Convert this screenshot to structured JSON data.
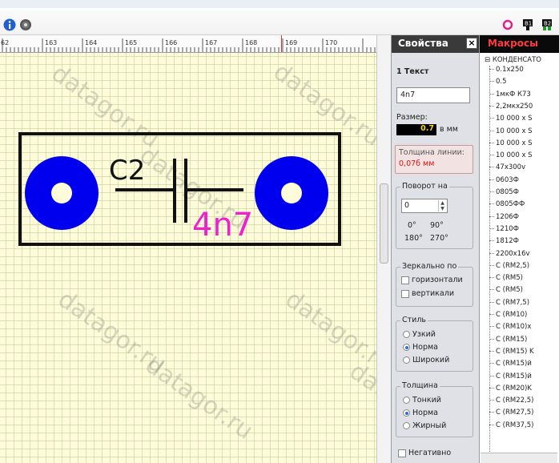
{
  "toolbar": {
    "left_icons": [
      "info-icon",
      "gear-icon"
    ],
    "right_icons": [
      "ring-icon",
      "layer-tool-icon",
      "layer-tool-2-icon"
    ],
    "icon_labels": {
      "layer1": "B1",
      "layer2": "B2"
    }
  },
  "ruler": {
    "labels": [
      "62",
      "163",
      "164",
      "165",
      "166",
      "167",
      "168",
      "169",
      "170"
    ]
  },
  "canvas": {
    "designator": "C2",
    "value": "4n7",
    "watermark": "datagor.ru",
    "colors": {
      "pad": "#0000ee",
      "silk": "#111111",
      "value_text": "#ee22cc",
      "background": "#fdfbd9"
    }
  },
  "props": {
    "title": "Свойства",
    "close": "×",
    "section": "1 Текст",
    "text_value": "4n7",
    "size_label": "Размер:",
    "size_value": "0.7",
    "size_unit": "в мм",
    "line_thickness_label": "Толщина линии:",
    "line_thickness_value": "0,07б мм",
    "rotation_label": "Поворот на",
    "rotation_value": "0",
    "rot0": "0°",
    "rot90": "90°",
    "rot180": "180°",
    "rot270": "270°",
    "mirror_label": "Зеркально по",
    "mirror_h": "горизонтали",
    "mirror_v": "вертикали",
    "style_label": "Стиль",
    "style_options": [
      "Узкий",
      "Норма",
      "Широкий"
    ],
    "style_selected": 1,
    "thickness_label": "Толщина",
    "thickness_options": [
      "Тонкий",
      "Норма",
      "Жирный"
    ],
    "thickness_selected": 1,
    "negative_label": "Негативно"
  },
  "macros": {
    "title": "Макросы",
    "root": "КОНДЕНСАТО",
    "items": [
      "0.1х250",
      "0.5",
      "1мкФ К73",
      "2,2мкх250",
      "10 000 х S",
      "10 000 х S",
      "10 000 х S",
      "10 000 х S",
      "47х300v",
      "0603Ф",
      "0805Ф",
      "0805ФФ",
      "1206Ф",
      "1210Ф",
      "1812Ф",
      "2200х16v",
      "C (RM2,5)",
      "C (RM5)",
      "C (RM5)",
      "C (RM7,5)",
      "C (RM10)",
      "C (RM10)х",
      "C (RM15)",
      "C (RM15) K",
      "C (RM15)й",
      "C (RM15)й",
      "C (RM20)K",
      "C (RM22,5)",
      "C (RM27,5)",
      "C (RM37,5)"
    ]
  }
}
